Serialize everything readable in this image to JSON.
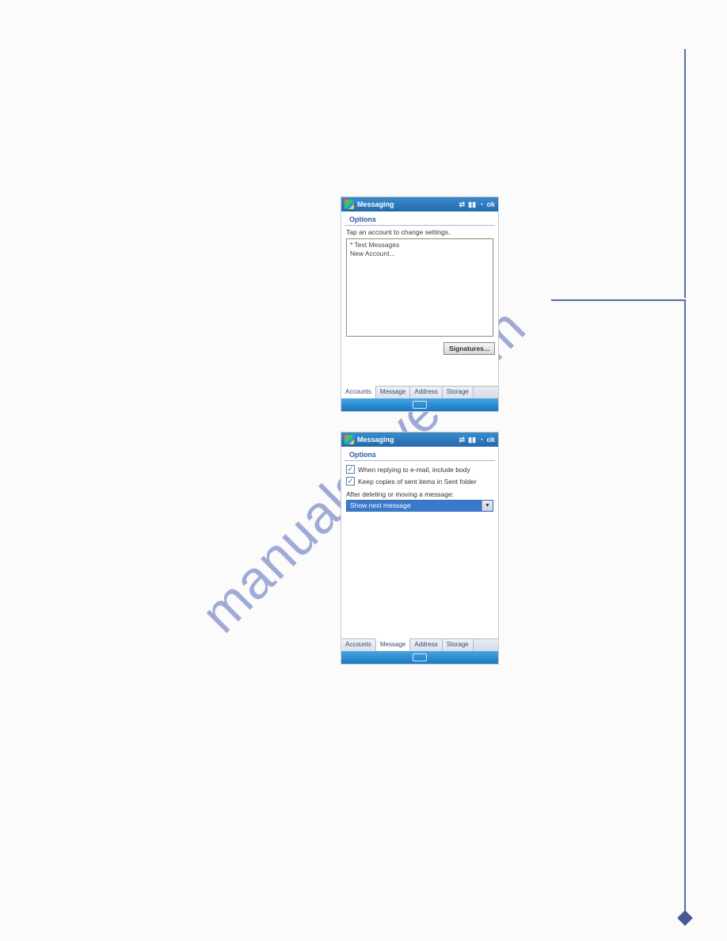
{
  "watermark": "manualshive.com",
  "screen1": {
    "title": "Messaging",
    "ok": "ok",
    "options_heading": "Options",
    "instruction": "Tap an account to change settings.",
    "accounts": {
      "item0": "* Text Messages",
      "item1": "New Account..."
    },
    "signatures_btn": "Signatures...",
    "tabs": {
      "t0": "Accounts",
      "t1": "Message",
      "t2": "Address",
      "t3": "Storage"
    }
  },
  "screen2": {
    "title": "Messaging",
    "ok": "ok",
    "options_heading": "Options",
    "checkbox1": "When replying to e-mail, include body",
    "checkbox2": "Keep copies of sent items in Sent folder",
    "after_label": "After deleting or moving a message:",
    "dropdown_value": "Show next message",
    "tabs": {
      "t0": "Accounts",
      "t1": "Message",
      "t2": "Address",
      "t3": "Storage"
    }
  }
}
